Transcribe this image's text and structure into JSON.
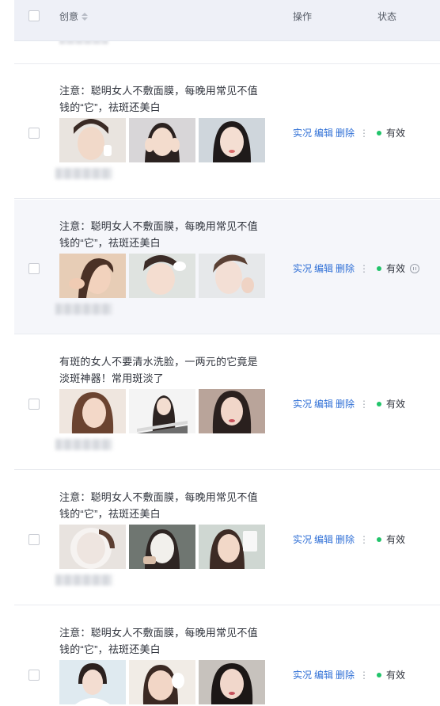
{
  "header": {
    "creative_label": "创意",
    "actions_label": "操作",
    "status_label": "状态"
  },
  "rows": [
    {
      "title": "注意：聪明女人不敷面膜，每晚用常见不值钱的“它”，祛斑还美白",
      "actions": [
        "实况",
        "编辑",
        "删除"
      ],
      "more": "⋮",
      "status": "有效",
      "status_color": "#21c46a"
    },
    {
      "title": "注意：聪明女人不敷面膜，每晚用常见不值钱的“它”，祛斑还美白",
      "actions": [
        "实况",
        "编辑",
        "删除"
      ],
      "more": "⋮",
      "status": "有效",
      "status_color": "#21c46a"
    },
    {
      "title": "有斑的女人不要清水洗脸，一两元的它竟是淡斑神器！常用斑淡了",
      "actions": [
        "实况",
        "编辑",
        "删除"
      ],
      "more": "⋮",
      "status": "有效",
      "status_color": "#21c46a"
    },
    {
      "title": "注意：聪明女人不敷面膜，每晚用常见不值钱的“它”，祛斑还美白",
      "actions": [
        "实况",
        "编辑",
        "删除"
      ],
      "more": "⋮",
      "status": "有效",
      "status_color": "#21c46a"
    },
    {
      "title": "注意：聪明女人不敷面膜，每晚用常见不值钱的“它”，祛斑还美白",
      "actions": [
        "实况",
        "编辑",
        "删除"
      ],
      "more": "⋮",
      "status": "有效",
      "status_color": "#21c46a"
    }
  ],
  "colors": {
    "link": "#2f6fd6",
    "header_bg": "#eef0f7",
    "hover_row_bg": "#f5f6fa"
  }
}
